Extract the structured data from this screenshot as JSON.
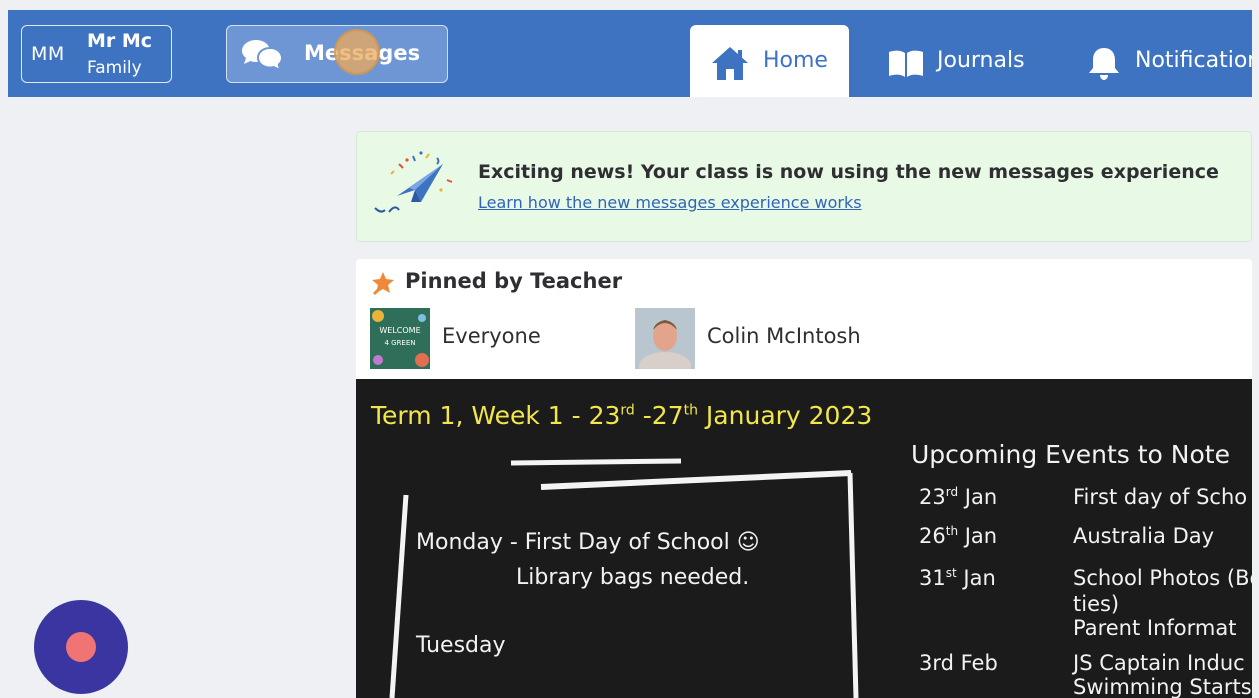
{
  "user": {
    "initials": "MM",
    "name": "Mr Mc",
    "family": "Family"
  },
  "header": {
    "messages_label": "Messages",
    "tabs": [
      {
        "label": "Home",
        "icon": "house-icon",
        "active": true
      },
      {
        "label": "Journals",
        "icon": "book-icon",
        "active": false
      },
      {
        "label": "Notifications",
        "icon": "bell-icon",
        "active": false
      }
    ]
  },
  "banner": {
    "title": "Exciting news! Your class is now using the new messages experience",
    "link": "Learn how the new messages experience works",
    "icon": "paper-plane-celebration-icon"
  },
  "post": {
    "pinned_label": "Pinned by Teacher",
    "recipients": [
      {
        "name": "Everyone",
        "thumb_lines": [
          "WELCOME",
          "4 GREEN"
        ]
      },
      {
        "name": "Colin McIntosh"
      }
    ],
    "board": {
      "heading_parts": [
        "Term 1, Week 1 - 23",
        "rd",
        " -27",
        "th",
        " January 2023"
      ],
      "left_lines": {
        "monday": "Monday - First Day of School ☺",
        "library": "Library bags needed.",
        "tuesday": "Tuesday"
      },
      "events_title": "Upcoming Events to Note",
      "events": [
        {
          "day": "23",
          "suffix": "rd",
          "month": " Jan",
          "text": "First day of Scho"
        },
        {
          "day": "26",
          "suffix": "th",
          "month": " Jan",
          "text": "Australia Day"
        },
        {
          "day": "31",
          "suffix": "st",
          "month": " Jan",
          "text": "School Photos (Bo",
          "text2": "ties)",
          "text3": "Parent Informat"
        },
        {
          "day": "3rd Feb",
          "suffix": "",
          "month": "",
          "text": "JS Captain Induc",
          "text2": "Swimming Starts"
        }
      ]
    }
  },
  "colors": {
    "navbar": "#3e73c2",
    "banner_bg": "#e8f9e6",
    "fab": "#3a35a1",
    "fab_dot": "#f07474",
    "chalk_yellow": "#f2e64a"
  }
}
